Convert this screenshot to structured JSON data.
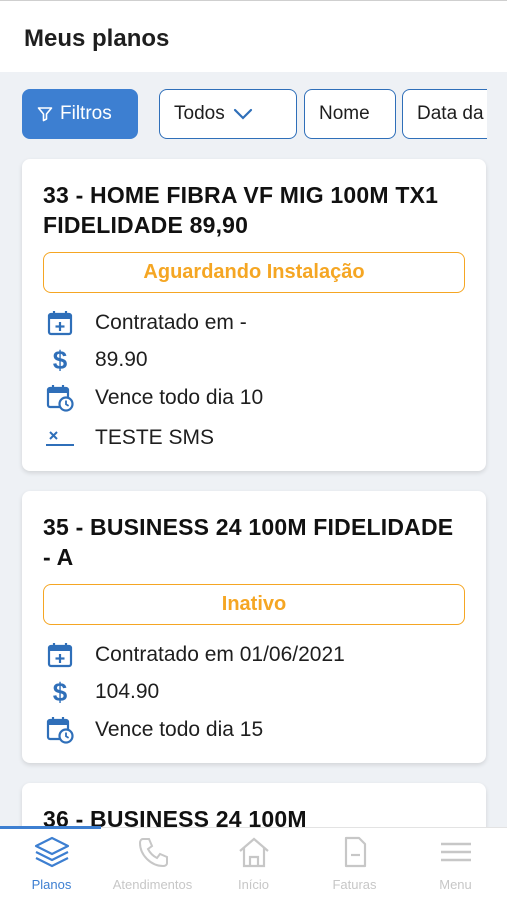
{
  "header": {
    "title": "Meus planos"
  },
  "filters": {
    "filter_button": "Filtros",
    "chips": [
      "Todos",
      "Nome",
      "Data da"
    ]
  },
  "plans": [
    {
      "title": "33 - HOME FIBRA VF MIG 100M TX1 FIDELIDADE 89,90",
      "status": "Aguardando Instalação",
      "contracted": "Contratado em -",
      "price": "89.90",
      "due": "Vence todo dia 10",
      "extra": "TESTE SMS"
    },
    {
      "title": "35 - BUSINESS 24 100M FIDELIDADE - A",
      "status": "Inativo",
      "contracted": "Contratado em 01/06/2021",
      "price": "104.90",
      "due": "Vence todo dia 15"
    },
    {
      "title": "36 - BUSINESS 24 100M"
    }
  ],
  "bottom_nav": [
    {
      "label": "Planos",
      "icon": "layers-icon",
      "active": true
    },
    {
      "label": "Atendimentos",
      "icon": "phone-icon",
      "active": false
    },
    {
      "label": "Início",
      "icon": "home-icon",
      "active": false
    },
    {
      "label": "Faturas",
      "icon": "document-icon",
      "active": false
    },
    {
      "label": "Menu",
      "icon": "menu-icon",
      "active": false
    }
  ],
  "colors": {
    "primary": "#3d7fd1",
    "status_orange": "#f5a623",
    "inactive_nav": "#c7c7c7"
  }
}
